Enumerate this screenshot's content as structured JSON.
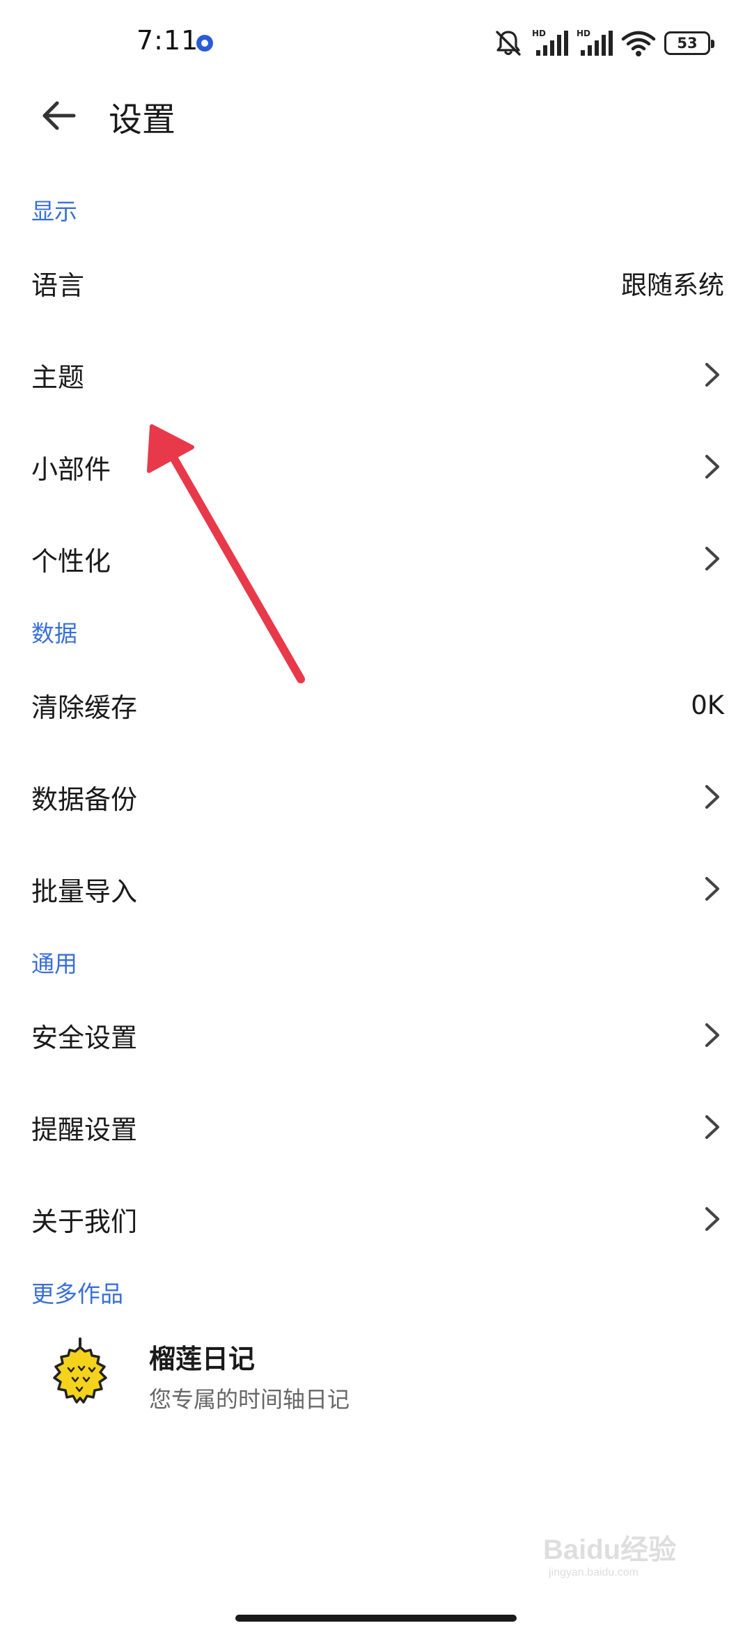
{
  "status_bar": {
    "time": "7:11",
    "battery": "53",
    "network_label_1": "HD",
    "network_label_2": "HD"
  },
  "header": {
    "title": "设置"
  },
  "sections": [
    {
      "title": "显示",
      "items": [
        {
          "label": "语言",
          "value": "跟随系统"
        },
        {
          "label": "主题"
        },
        {
          "label": "小部件"
        },
        {
          "label": "个性化"
        }
      ]
    },
    {
      "title": "数据",
      "items": [
        {
          "label": "清除缓存",
          "value": "0K"
        },
        {
          "label": "数据备份"
        },
        {
          "label": "批量导入"
        }
      ]
    },
    {
      "title": "通用",
      "items": [
        {
          "label": "安全设置"
        },
        {
          "label": "提醒设置"
        },
        {
          "label": "关于我们"
        }
      ]
    }
  ],
  "more_works": {
    "title": "更多作品",
    "app_name": "榴莲日记",
    "app_desc": "您专属的时间轴日记"
  },
  "watermark": {
    "text": "Baidu经验",
    "sub": "jingyan.baidu.com"
  },
  "colors": {
    "accent": "#3a6fd8",
    "arrow": "#e8394a",
    "status_dot": "#2a5bd7",
    "durian": "#f5d31c"
  }
}
